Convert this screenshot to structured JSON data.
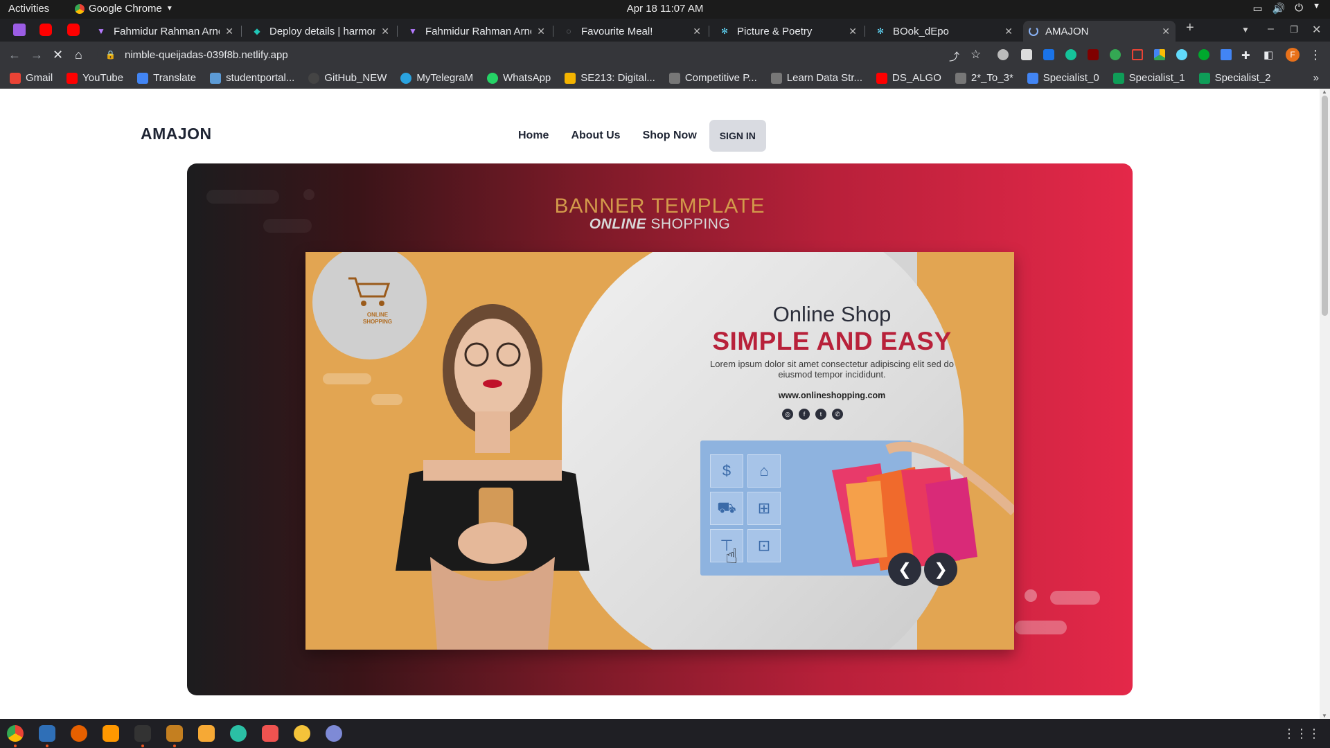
{
  "system": {
    "activities": "Activities",
    "app_name": "Google Chrome",
    "clock": "Apr 18  11:07 AM"
  },
  "tabs": [
    {
      "title": "Fahmidur Rahman Arno",
      "active": false
    },
    {
      "title": "Deploy details | harmon",
      "active": false
    },
    {
      "title": "Fahmidur Rahman Arno",
      "active": false
    },
    {
      "title": "Favourite Meal!",
      "active": false
    },
    {
      "title": "Picture & Poetry",
      "active": false
    },
    {
      "title": "BOok_dEpo",
      "active": false
    },
    {
      "title": "AMAJON",
      "active": true
    }
  ],
  "toolbar": {
    "url": "nimble-queijadas-039f8b.netlify.app",
    "profile_initial": "F"
  },
  "bookmarks": [
    {
      "label": "Gmail",
      "color": "#ea4335"
    },
    {
      "label": "YouTube",
      "color": "#ff0000"
    },
    {
      "label": "Translate",
      "color": "#4285f4"
    },
    {
      "label": "studentportal...",
      "color": "#5c9bd6"
    },
    {
      "label": "GitHub_NEW",
      "color": "#444444"
    },
    {
      "label": "MyTelegraM",
      "color": "#2aa3df"
    },
    {
      "label": "WhatsApp",
      "color": "#25d366"
    },
    {
      "label": "SE213: Digital...",
      "color": "#f4b400"
    },
    {
      "label": "Competitive P...",
      "color": "#777777"
    },
    {
      "label": "Learn Data Str...",
      "color": "#777777"
    },
    {
      "label": "DS_ALGO",
      "color": "#ff0000"
    },
    {
      "label": "2*_To_3*",
      "color": "#777777"
    },
    {
      "label": "Specialist_0",
      "color": "#4285f4"
    },
    {
      "label": "Specialist_1",
      "color": "#0f9d58"
    },
    {
      "label": "Specialist_2",
      "color": "#0f9d58"
    }
  ],
  "site": {
    "brand": "AMAJON",
    "nav": [
      "Home",
      "About Us",
      "Shop Now"
    ],
    "signin": "SIGN IN"
  },
  "banner": {
    "title": "BANNER TEMPLATE",
    "subtitle_bold": "ONLINE",
    "subtitle_rest": " SHOPPING",
    "cart_logo_text": "ONLINE SHOPPING",
    "headline": "Online Shop",
    "headline_strong": "SIMPLE AND EASY",
    "lorem": "Lorem ipsum dolor sit amet consectetur adipiscing elit sed do eiusmod tempor incididunt.",
    "url": "www.onlineshopping.com",
    "prev": "❮",
    "next": "❯"
  },
  "colors": {
    "accent_red": "#e42849",
    "banner_orange": "#e2a552",
    "nav_text": "#1e2433"
  }
}
